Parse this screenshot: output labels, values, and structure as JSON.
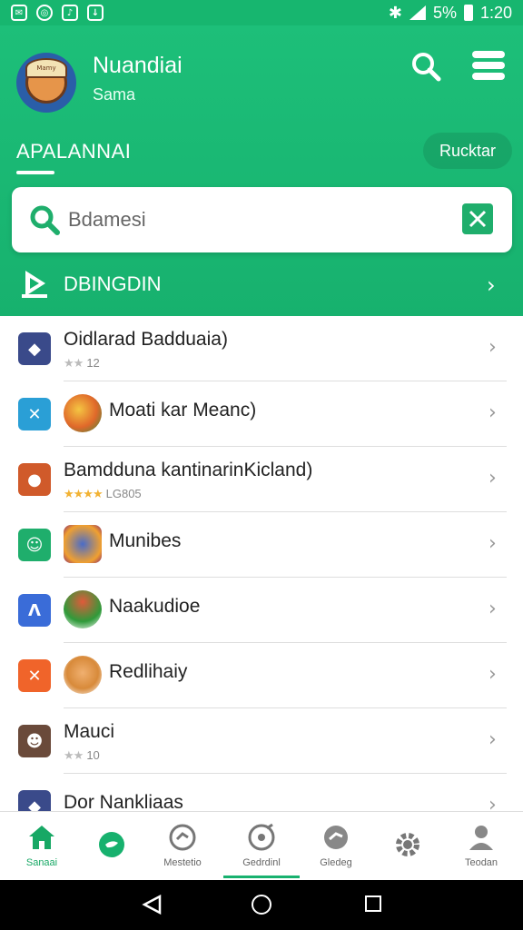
{
  "status_bar": {
    "battery": "5%",
    "time": "1:20"
  },
  "header": {
    "user_name": "Nuandiai",
    "user_subtitle": "Sama",
    "avatar_badge": "Mamy",
    "section_title": "APALANNAI",
    "pill_button": "Rucktar",
    "search_placeholder": "Bdamesi",
    "category_label": "DBINGDIN"
  },
  "list": {
    "items": [
      {
        "title": "Oidlarad Badduaia)",
        "rating_text": "12",
        "stars": "★★",
        "icon_color": "#3a4a8a",
        "thumb": ""
      },
      {
        "title": "Moati kar Meanc)",
        "rating_text": "",
        "stars": "",
        "icon_color": "#2a9fd6",
        "thumb": "#e0682a"
      },
      {
        "title": "Bamdduna kantinarinKicland)",
        "rating_text": "LG805",
        "stars": "★★★★",
        "icon_color": "#d05a2a",
        "thumb": ""
      },
      {
        "title": "Munibes",
        "rating_text": "",
        "stars": "",
        "icon_color": "#1fae6c",
        "thumb": "#4a6cc8"
      },
      {
        "title": "Naakudioe",
        "rating_text": "",
        "stars": "",
        "icon_color": "#3a6cd8",
        "thumb": "#2f9a3a"
      },
      {
        "title": "Redlihaiy",
        "rating_text": "",
        "stars": "",
        "icon_color": "#f0642a",
        "thumb": "#d88a3a"
      },
      {
        "title": "Mauci",
        "rating_text": "10",
        "stars": "★★",
        "icon_color": "#6a4a3a",
        "thumb": ""
      },
      {
        "title": "Dor Nankliaas",
        "rating_text": "",
        "stars": "",
        "icon_color": "#3a4a8a",
        "thumb": ""
      }
    ]
  },
  "bottom_nav": {
    "items": [
      {
        "label": "Sanaai"
      },
      {
        "label": ""
      },
      {
        "label": "Mestetio"
      },
      {
        "label": "Gedrdinl"
      },
      {
        "label": "Gledeg"
      },
      {
        "label": ""
      },
      {
        "label": "Teodan"
      }
    ]
  },
  "colors": {
    "brand_green": "#17b16e",
    "active_tab": "#17a865"
  }
}
